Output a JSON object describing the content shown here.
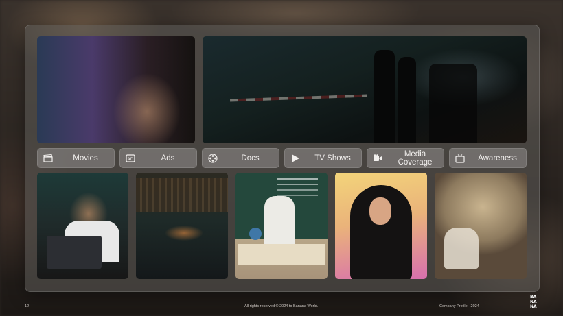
{
  "categories": [
    {
      "label": "Movies",
      "icon": "clapperboard-icon"
    },
    {
      "label": "Ads",
      "icon": "ad-icon"
    },
    {
      "label": "Docs",
      "icon": "film-reel-icon"
    },
    {
      "label": "TV Shows",
      "icon": "play-icon"
    },
    {
      "label": "Media Coverage",
      "icon": "camera-icon"
    },
    {
      "label": "Awareness",
      "icon": "tv-icon"
    }
  ],
  "footer": {
    "page_number": "12",
    "copyright": "All rights reserved © 2024 to Banana World.",
    "doc_title": "Company Profile - 2024"
  },
  "logo_text": "BANANA"
}
